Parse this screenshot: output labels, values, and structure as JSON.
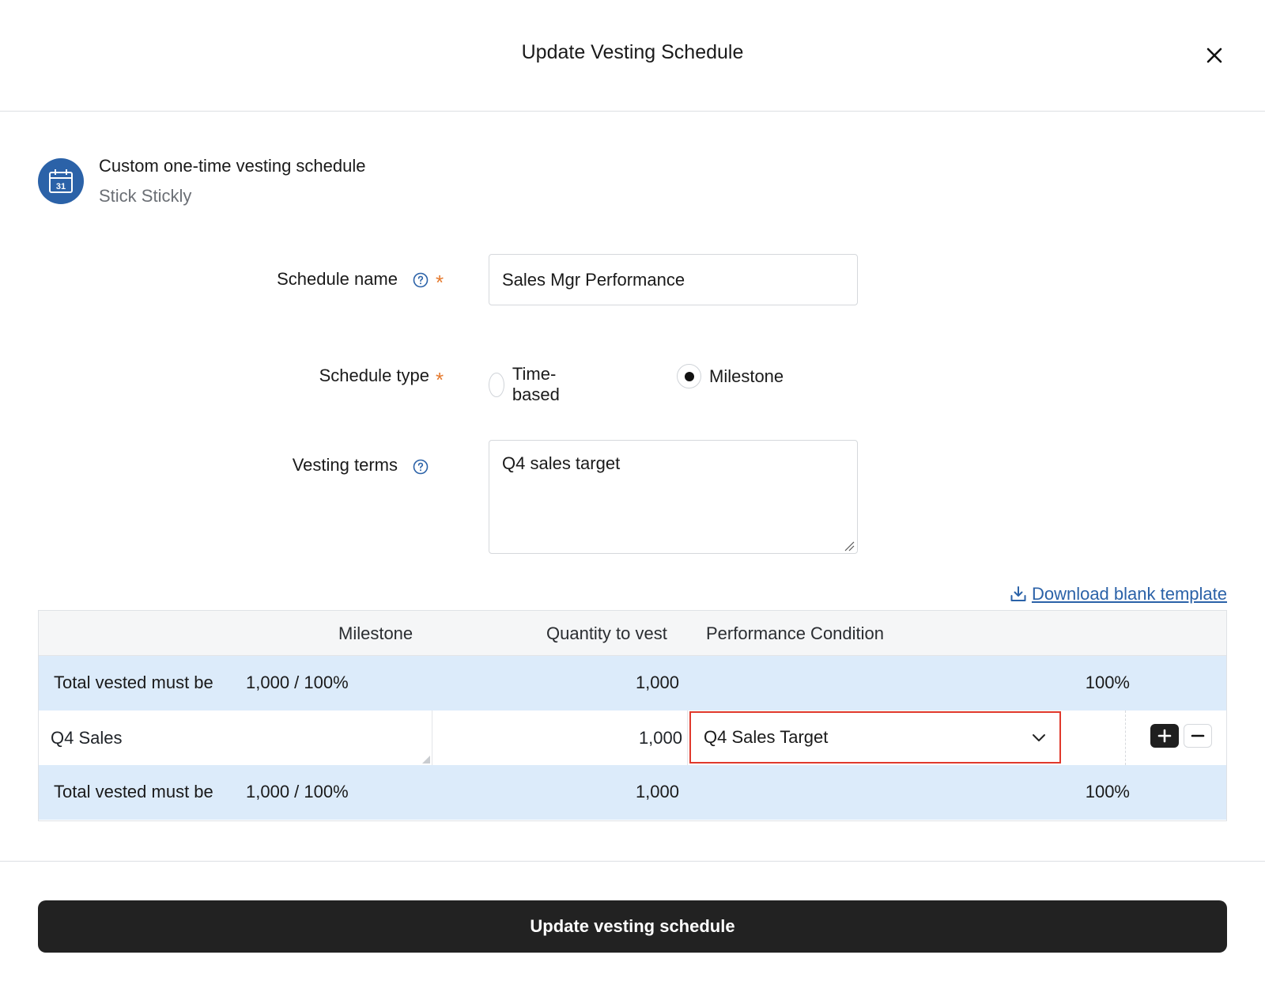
{
  "modal": {
    "title": "Update Vesting Schedule"
  },
  "summary": {
    "title": "Custom one-time vesting schedule",
    "subtitle": "Stick Stickly",
    "icon_day": "31"
  },
  "form": {
    "schedule_name": {
      "label": "Schedule name",
      "value": "Sales Mgr Performance",
      "required": true
    },
    "schedule_type": {
      "label": "Schedule type",
      "required": true,
      "options": [
        "Time-based",
        "Milestone"
      ],
      "selected": "Milestone"
    },
    "vesting_terms": {
      "label": "Vesting terms",
      "value": "Q4 sales target"
    }
  },
  "download_template": "Download blank template",
  "table": {
    "headers": [
      "Milestone",
      "Quantity to vest",
      "Performance Condition"
    ],
    "total_label": "Total vested must be",
    "total_required": "1,000 / 100%",
    "total_top": {
      "quantity": "1,000",
      "percent": "100%"
    },
    "rows": [
      {
        "milestone": "Q4 Sales",
        "quantity": "1,000",
        "condition": "Q4 Sales Target"
      }
    ],
    "total_bottom": {
      "quantity": "1,000",
      "percent": "100%"
    }
  },
  "submit_label": "Update vesting schedule",
  "colors": {
    "accent": "#2b62a8",
    "required": "#e57a2e",
    "highlight": "#e0392c",
    "total_row": "#dcebfa"
  }
}
